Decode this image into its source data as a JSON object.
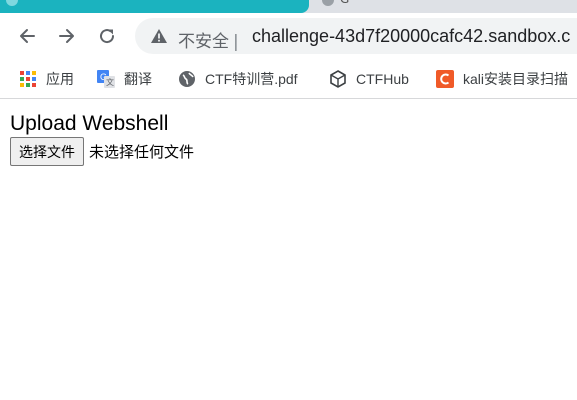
{
  "tabs": {
    "next_tab_title": "G"
  },
  "toolbar": {
    "back_icon": "arrow-left-icon",
    "forward_icon": "arrow-right-icon",
    "reload_icon": "reload-icon",
    "security_icon": "warning-triangle-icon",
    "security_label": "不安全",
    "url": "challenge-43d7f20000cafc42.sandbox.c"
  },
  "bookmarks": [
    {
      "label": "应用",
      "icon": "apps-grid-icon"
    },
    {
      "label": "翻译",
      "icon": "translate-icon"
    },
    {
      "label": "CTF特训营.pdf",
      "icon": "globe-icon"
    },
    {
      "label": "CTFHub",
      "icon": "cube-icon"
    },
    {
      "label": "kali安装目录扫描",
      "icon": "bookmark-c-icon"
    }
  ],
  "page": {
    "title": "Upload Webshell",
    "file_button_label": "选择文件",
    "file_status": "未选择任何文件"
  },
  "colors": {
    "active_tab": "#1bb3bf",
    "omnibox_bg": "#f1f3f4",
    "bookmark_c_icon": "#f05a28"
  }
}
